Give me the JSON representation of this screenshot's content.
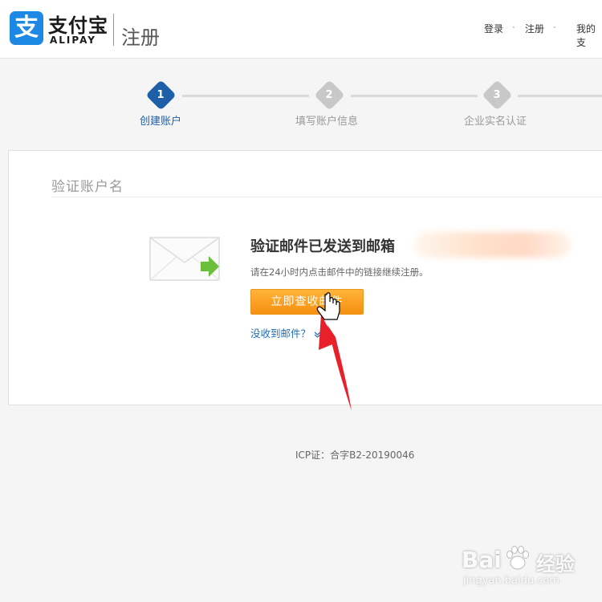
{
  "header": {
    "logo_char": "支",
    "brand_cn": "支付宝",
    "brand_en": "ALIPAY",
    "page_name": "注册",
    "nav": {
      "login": "登录",
      "separator": "·",
      "register": "注册",
      "my_alipay": "我的支"
    }
  },
  "steps": [
    {
      "number": "1",
      "label": "创建账户",
      "status": "current"
    },
    {
      "number": "2",
      "label": "填写账户信息",
      "status": "pending"
    },
    {
      "number": "3",
      "label": "企业实名认证",
      "status": "pending"
    }
  ],
  "card": {
    "title": "验证账户名",
    "message_title": "验证邮件已发送到邮箱",
    "message_sub": "请在24小时内点击邮件中的链接继续注册。",
    "check_button": "立即查收邮件",
    "no_mail_link": "没收到邮件？",
    "no_mail_chevron": "chevron-down-icon"
  },
  "footer": {
    "icp": "ICP证：合字B2-20190046"
  },
  "watermark": {
    "brand": "Bai",
    "brand2": "经验",
    "url": "jingyan.baidu.com"
  },
  "colors": {
    "brand_blue": "#1e88e5",
    "active_step": "#1e5fa8",
    "pending_step": "#c8c8c8",
    "button_orange": "#f7a022",
    "link_blue": "#1e6fbf",
    "annotation_red": "#e8202a"
  }
}
